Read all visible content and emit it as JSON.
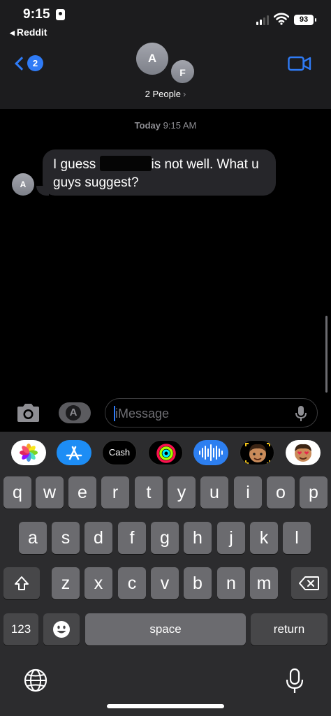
{
  "status_bar": {
    "time": "9:15",
    "back_app": "Reddit",
    "battery": "93",
    "signal_bars_filled": 2,
    "icons": [
      "contact-card-icon",
      "signal-icon",
      "wifi-icon",
      "battery-icon"
    ]
  },
  "header": {
    "back_badge": "2",
    "avatar_1": "A",
    "avatar_2": "F",
    "title": "2 People",
    "title_chevron": "›",
    "video_icon": "video-camera-icon",
    "accent": "#2f7bf6"
  },
  "conversation": {
    "timestamp_day": "Today",
    "timestamp_time": "9:15 AM",
    "messages": [
      {
        "sender_initial": "A",
        "text_before": "I guess",
        "text_after": "is not well. What u guys suggest?",
        "redacted": true
      }
    ]
  },
  "input_bar": {
    "placeholder": "iMessage",
    "camera_icon": "camera-icon",
    "apps_icon": "app-store-icon",
    "mic_icon": "microphone-icon"
  },
  "app_drawer": {
    "apps": [
      {
        "name": "photos-app-icon",
        "label": ""
      },
      {
        "name": "app-store-app-icon",
        "label": ""
      },
      {
        "name": "apple-cash-app-icon",
        "label": "Cash"
      },
      {
        "name": "activity-app-icon",
        "label": ""
      },
      {
        "name": "audio-message-app-icon",
        "label": ""
      },
      {
        "name": "memoji-app-icon",
        "label": ""
      },
      {
        "name": "memoji-stickers-app-icon",
        "label": ""
      }
    ]
  },
  "keyboard": {
    "row1": [
      "q",
      "w",
      "e",
      "r",
      "t",
      "y",
      "u",
      "i",
      "o",
      "p"
    ],
    "row2": [
      "a",
      "s",
      "d",
      "f",
      "g",
      "h",
      "j",
      "k",
      "l"
    ],
    "row3": [
      "z",
      "x",
      "c",
      "v",
      "b",
      "n",
      "m"
    ],
    "numbers_key": "123",
    "space_key": "space",
    "return_key": "return",
    "icons": [
      "shift-icon",
      "backspace-icon",
      "emoji-icon",
      "globe-icon",
      "dictation-icon"
    ]
  }
}
